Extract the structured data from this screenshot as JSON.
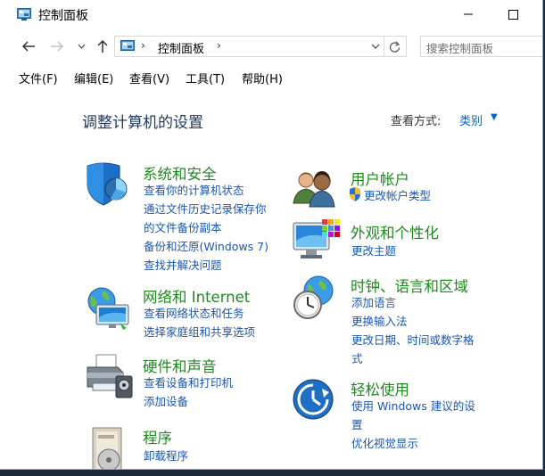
{
  "window": {
    "title": "控制面板"
  },
  "address": {
    "segment": "控制面板",
    "search_placeholder": "搜索控制面板"
  },
  "menu": [
    "文件(F)",
    "编辑(E)",
    "查看(V)",
    "工具(T)",
    "帮助(H)"
  ],
  "header": {
    "title": "调整计算机的设置",
    "view_by_label": "查看方式:",
    "view_by_value": "类别"
  },
  "categories": {
    "system": {
      "title": "系统和安全",
      "links": [
        "查看你的计算机状态",
        "通过文件历史记录保存你",
        "的文件备份副本",
        "备份和还原(Windows 7)",
        "查找并解决问题"
      ]
    },
    "network": {
      "title": "网络和 Internet",
      "links": [
        "查看网络状态和任务",
        "选择家庭组和共享选项"
      ]
    },
    "hardware": {
      "title": "硬件和声音",
      "links": [
        "查看设备和打印机",
        "添加设备"
      ]
    },
    "programs": {
      "title": "程序",
      "links": [
        "卸载程序"
      ]
    },
    "accounts": {
      "title": "用户帐户",
      "links": [
        "更改帐户类型"
      ]
    },
    "appearance": {
      "title": "外观和个性化",
      "links": [
        "更改主题"
      ]
    },
    "clock": {
      "title": "时钟、语言和区域",
      "links": [
        "添加语言",
        "更换输入法",
        "更改日期、时间或数字格",
        "式"
      ]
    },
    "ease": {
      "title": "轻松使用",
      "links": [
        "使用 Windows 建议的设",
        "置",
        "优化视觉显示"
      ]
    }
  },
  "colors": {
    "category_title": "#1e8a1e",
    "link": "#1a56b4",
    "page_title": "#1e395b"
  },
  "icons": [
    "control-panel-icon",
    "minimize-icon",
    "maximize-icon",
    "back-arrow-icon",
    "forward-arrow-icon",
    "recent-locations-icon",
    "up-arrow-icon",
    "refresh-icon",
    "chevron-down-icon",
    "shield-icon",
    "users-icon",
    "display-icon",
    "globe-network-icon",
    "clock-globe-icon",
    "printer-icon",
    "ease-of-access-icon",
    "programs-icon",
    "uac-shield-icon"
  ]
}
